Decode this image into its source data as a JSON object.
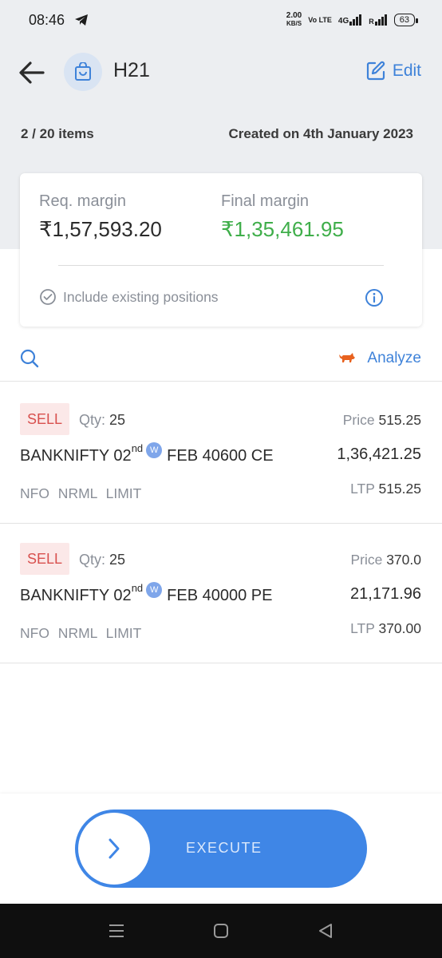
{
  "statusbar": {
    "time": "08:46",
    "net_speed_value": "2.00",
    "net_speed_unit": "KB/S",
    "volte": "Vo LTE",
    "network": "4G",
    "roaming": "R",
    "battery": "63"
  },
  "header": {
    "title": "H21",
    "edit_label": "Edit"
  },
  "meta": {
    "items_count": "2 / 20 items",
    "created": "Created on 4th January 2023"
  },
  "margin_card": {
    "req_label": "Req. margin",
    "req_value": "₹1,57,593.20",
    "final_label": "Final margin",
    "final_value": "₹1,35,461.95",
    "include_label": "Include existing positions"
  },
  "toolbar": {
    "analyze_label": "Analyze"
  },
  "orders": [
    {
      "side": "SELL",
      "qty_label": "Qty:",
      "qty": "25",
      "price_label": "Price",
      "price": "515.25",
      "symbol_pre": "BANKNIFTY 02",
      "symbol_sup": "nd",
      "weekly_badge": "W",
      "symbol_post": "FEB 40600 CE",
      "amount": "1,36,421.25",
      "tags": "NFO NRML LIMIT",
      "ltp_label": "LTP",
      "ltp": "515.25"
    },
    {
      "side": "SELL",
      "qty_label": "Qty:",
      "qty": "25",
      "price_label": "Price",
      "price": "370.0",
      "symbol_pre": "BANKNIFTY 02",
      "symbol_sup": "nd",
      "weekly_badge": "W",
      "symbol_post": "FEB 40000 PE",
      "amount": "21,171.96",
      "tags": "NFO NRML LIMIT",
      "ltp_label": "LTP",
      "ltp": "370.00"
    }
  ],
  "execute": {
    "label": "EXECUTE"
  },
  "colors": {
    "accent": "#3e82d9",
    "sell_text": "#d8504e",
    "sell_bg": "#fbe8e8",
    "positive": "#3fae4a",
    "execute_bg": "#3f86e6"
  }
}
